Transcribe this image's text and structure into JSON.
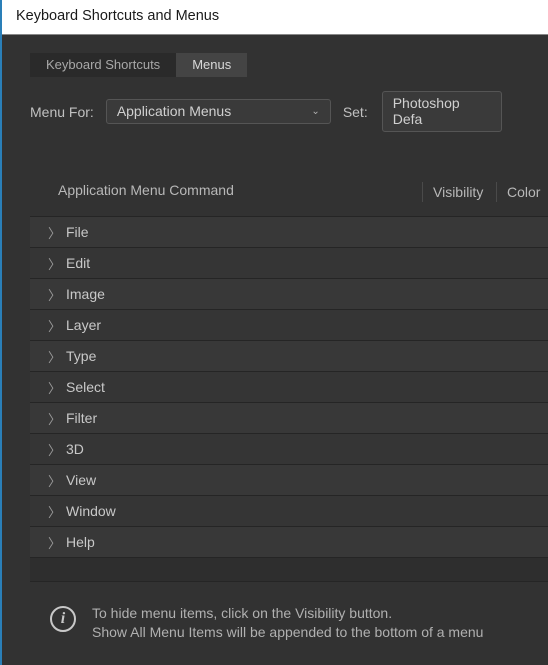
{
  "window": {
    "title": "Keyboard Shortcuts and Menus"
  },
  "tabs": {
    "shortcuts": "Keyboard Shortcuts",
    "menus": "Menus"
  },
  "toolbar": {
    "menu_for_label": "Menu For:",
    "menu_for_value": "Application Menus",
    "set_label": "Set:",
    "set_value": "Photoshop Defa"
  },
  "columns": {
    "command": "Application Menu Command",
    "visibility": "Visibility",
    "color": "Color"
  },
  "menu_items": [
    {
      "label": "File"
    },
    {
      "label": "Edit"
    },
    {
      "label": "Image"
    },
    {
      "label": "Layer"
    },
    {
      "label": "Type"
    },
    {
      "label": "Select"
    },
    {
      "label": "Filter"
    },
    {
      "label": "3D"
    },
    {
      "label": "View"
    },
    {
      "label": "Window"
    },
    {
      "label": "Help"
    }
  ],
  "info": {
    "line1": "To hide menu items, click on the Visibility button.",
    "line2": "Show All Menu Items will be appended to the bottom of a menu "
  }
}
